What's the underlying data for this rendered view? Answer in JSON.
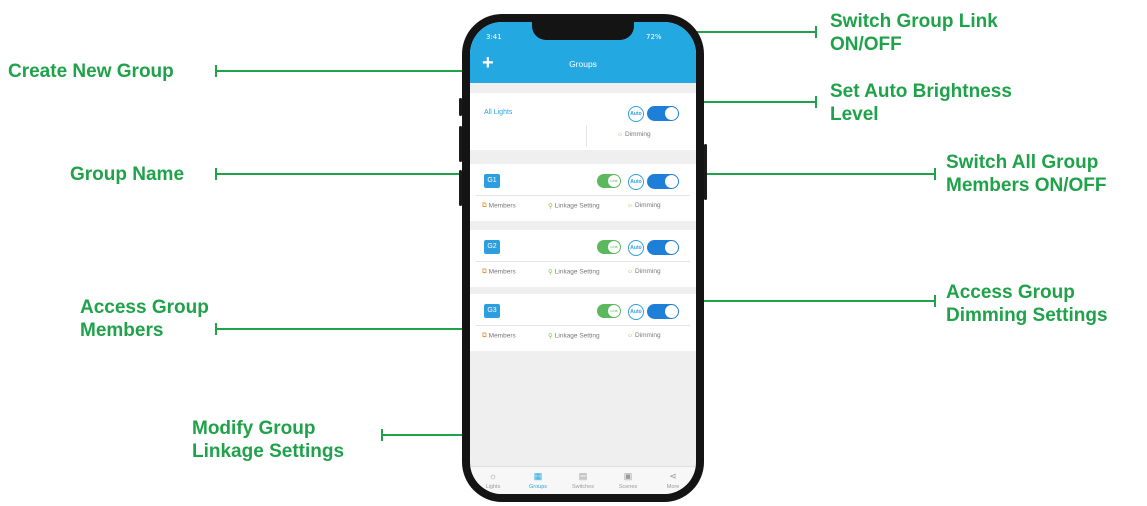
{
  "callouts": {
    "create_new_group": "Create New Group",
    "group_name": "Group Name",
    "access_group_members_1": "Access Group",
    "access_group_members_2": "Members",
    "modify_linkage_1": "Modify Group",
    "modify_linkage_2": "Linkage Settings",
    "switch_link_1": "Switch Group Link",
    "switch_link_2": "ON/OFF",
    "auto_brightness_1": "Set Auto Brightness",
    "auto_brightness_2": "Level",
    "switch_all_1": "Switch All Group",
    "switch_all_2": "Members ON/OFF",
    "access_dimming_1": "Access Group",
    "access_dimming_2": "Dimming Settings"
  },
  "colors": {
    "accent_green": "#1fa24a",
    "app_blue": "#24a8e2",
    "toggle_blue": "#1e7fd9",
    "link_green": "#5cb85c"
  },
  "phone": {
    "status_time": "3:41",
    "status_battery": "72%",
    "app_title": "Groups",
    "add_icon": "plus-icon",
    "all_lights": {
      "label": "All Lights",
      "auto": "Auto",
      "dimming": "Dimming"
    },
    "groups": [
      {
        "name": "G1",
        "link": "Link",
        "auto": "Auto",
        "members": "Members",
        "linkage": "Linkage Setting",
        "dimming": "Dimming"
      },
      {
        "name": "G2",
        "link": "Link",
        "auto": "Auto",
        "members": "Members",
        "linkage": "Linkage Setting",
        "dimming": "Dimming"
      },
      {
        "name": "G3",
        "link": "Link",
        "auto": "Auto",
        "members": "Members",
        "linkage": "Linkage Setting",
        "dimming": "Dimming"
      }
    ],
    "tabs": [
      {
        "label": "Lights",
        "icon": "bulb-icon"
      },
      {
        "label": "Groups",
        "icon": "groups-icon",
        "active": true
      },
      {
        "label": "Switches",
        "icon": "switch-icon"
      },
      {
        "label": "Scenes",
        "icon": "scene-icon"
      },
      {
        "label": "More",
        "icon": "share-icon"
      }
    ]
  }
}
